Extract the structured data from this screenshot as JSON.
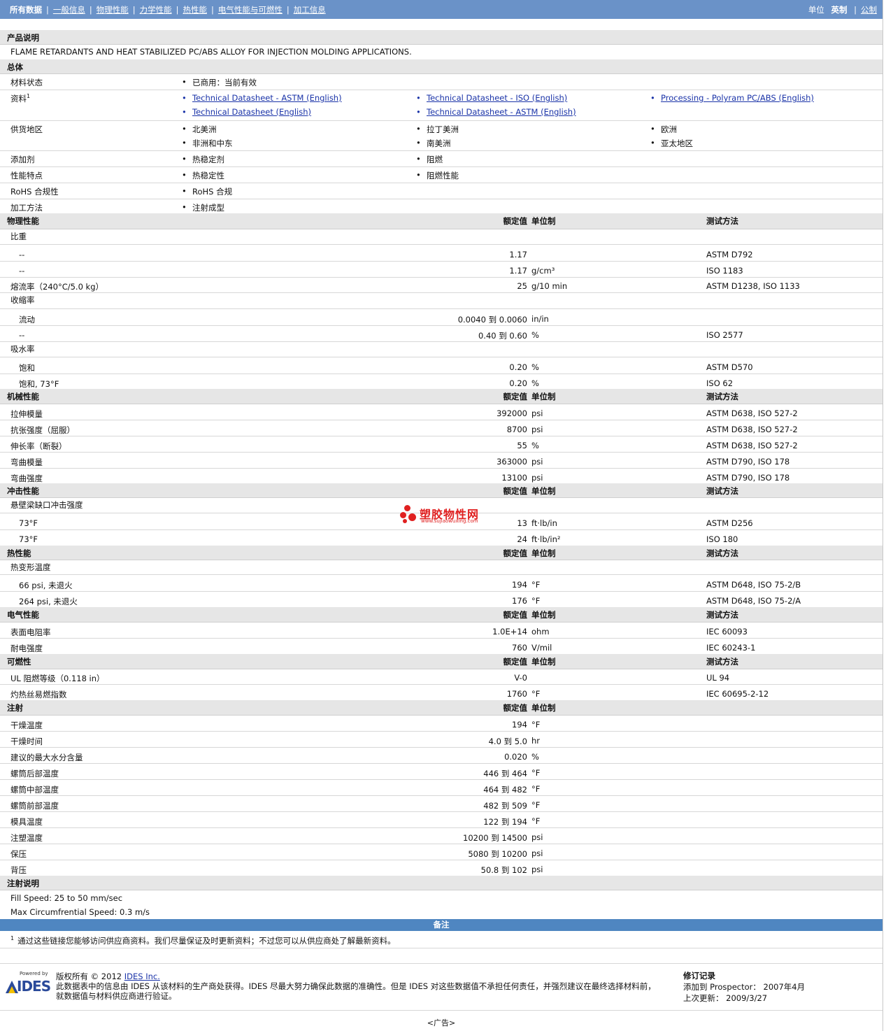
{
  "nav": {
    "tabs": [
      "所有数据",
      "一般信息",
      "物理性能",
      "力学性能",
      "热性能",
      "电气性能与可燃性",
      "加工信息"
    ],
    "units_label": "单位",
    "unit_imperial": "英制",
    "unit_metric": "公制"
  },
  "product_desc": {
    "title": "产品说明",
    "text": "FLAME RETARDANTS AND HEAT STABILIZED PC/ABS ALLOY FOR INJECTION MOLDING APPLICATIONS."
  },
  "general": {
    "title": "总体",
    "rows": [
      {
        "label": "材料状态",
        "items": [
          "已商用：当前有效"
        ]
      },
      {
        "label": "资料",
        "sup": "1",
        "items": [
          "Technical Datasheet - ASTM (English)",
          "Technical Datasheet - ISO (English)",
          "Processing - Polyram PC/ABS (English)",
          "Technical Datasheet (English)",
          "Technical Datasheet - ASTM (English)"
        ]
      },
      {
        "label": "供货地区",
        "items": [
          "北美洲",
          "拉丁美洲",
          "欧洲",
          "非洲和中东",
          "南美洲",
          "亚太地区"
        ]
      },
      {
        "label": "添加剂",
        "items": [
          "热稳定剂",
          "阻燃"
        ]
      },
      {
        "label": "性能特点",
        "items": [
          "热稳定性",
          "阻燃性能"
        ]
      },
      {
        "label": "RoHS 合规性",
        "items": [
          "RoHS 合规"
        ]
      },
      {
        "label": "加工方法",
        "items": [
          "注射成型"
        ]
      }
    ]
  },
  "headers": {
    "value": "额定值",
    "unit": "单位制",
    "method": "测试方法"
  },
  "physical": {
    "title": "物理性能",
    "rows": [
      {
        "label": "比重",
        "group": true
      },
      {
        "label": "--",
        "sub": true,
        "value": "1.17",
        "unit": "",
        "method": "ASTM D792"
      },
      {
        "label": "--",
        "sub": true,
        "value": "1.17",
        "unit": "g/cm³",
        "method": "ISO 1183"
      },
      {
        "label": "熔流率（240°C/5.0 kg）",
        "value": "25",
        "unit": "g/10 min",
        "method": "ASTM D1238, ISO 1133"
      },
      {
        "label": "收缩率",
        "group": true
      },
      {
        "label": "流动",
        "sub": true,
        "value": "0.0040 到  0.0060",
        "unit": "in/in",
        "method": ""
      },
      {
        "label": "--",
        "sub": true,
        "value": "0.40 到  0.60",
        "unit": "%",
        "method": "ISO 2577"
      },
      {
        "label": "吸水率",
        "group": true
      },
      {
        "label": "饱和",
        "sub": true,
        "value": "0.20",
        "unit": "%",
        "method": "ASTM D570"
      },
      {
        "label": "饱和, 73°F",
        "sub": true,
        "value": "0.20",
        "unit": "%",
        "method": "ISO 62"
      }
    ]
  },
  "mechanical": {
    "title": "机械性能",
    "rows": [
      {
        "label": "拉伸模量",
        "value": "392000",
        "unit": "psi",
        "method": "ASTM D638, ISO 527-2"
      },
      {
        "label": "抗张强度（屈服）",
        "value": "8700",
        "unit": "psi",
        "method": "ASTM D638, ISO 527-2"
      },
      {
        "label": "伸长率（断裂）",
        "value": "55",
        "unit": "%",
        "method": "ASTM D638, ISO 527-2"
      },
      {
        "label": "弯曲模量",
        "value": "363000",
        "unit": "psi",
        "method": "ASTM D790, ISO 178"
      },
      {
        "label": "弯曲强度",
        "value": "13100",
        "unit": "psi",
        "method": "ASTM D790, ISO 178"
      }
    ]
  },
  "impact": {
    "title": "冲击性能",
    "rows": [
      {
        "label": "悬壁梁缺口冲击强度",
        "group": true
      },
      {
        "label": "73°F",
        "sub": true,
        "value": "13",
        "unit": "ft·lb/in",
        "method": "ASTM D256"
      },
      {
        "label": "73°F",
        "sub": true,
        "value": "24",
        "unit": "ft·lb/in²",
        "method": "ISO 180"
      }
    ]
  },
  "thermal": {
    "title": "热性能",
    "rows": [
      {
        "label": "热变形温度",
        "group": true
      },
      {
        "label": "66 psi, 未退火",
        "sub": true,
        "value": "194",
        "unit": "°F",
        "method": "ASTM D648, ISO 75-2/B"
      },
      {
        "label": "264 psi, 未退火",
        "sub": true,
        "value": "176",
        "unit": "°F",
        "method": "ASTM D648, ISO 75-2/A"
      }
    ]
  },
  "electrical": {
    "title": "电气性能",
    "rows": [
      {
        "label": "表面电阻率",
        "value": "1.0E+14",
        "unit": "ohm",
        "method": "IEC 60093"
      },
      {
        "label": "耐电强度",
        "value": "760",
        "unit": "V/mil",
        "method": "IEC 60243-1"
      }
    ]
  },
  "flammability": {
    "title": "可燃性",
    "rows": [
      {
        "label": "UL 阻燃等级（0.118 in）",
        "value": "V-0",
        "unit": "",
        "method": "UL 94"
      },
      {
        "label": "灼热丝易燃指数",
        "value": "1760",
        "unit": "°F",
        "method": "IEC 60695-2-12"
      }
    ]
  },
  "injection": {
    "title": "注射",
    "rows": [
      {
        "label": "干燥温度",
        "value": "194",
        "unit": "°F"
      },
      {
        "label": "干燥时间",
        "value": "4.0 到  5.0",
        "unit": "hr"
      },
      {
        "label": "建议的最大水分含量",
        "value": "0.020",
        "unit": "%"
      },
      {
        "label": "螺筒后部温度",
        "value": "446 到  464",
        "unit": "°F"
      },
      {
        "label": "螺筒中部温度",
        "value": "464 到  482",
        "unit": "°F"
      },
      {
        "label": "螺筒前部温度",
        "value": "482 到  509",
        "unit": "°F"
      },
      {
        "label": "模具温度",
        "value": "122 到  194",
        "unit": "°F"
      },
      {
        "label": "注塑温度",
        "value": "10200 到  14500",
        "unit": "psi"
      },
      {
        "label": "保压",
        "value": "5080 到  10200",
        "unit": "psi"
      },
      {
        "label": "背压",
        "value": "50.8 到  102",
        "unit": "psi"
      }
    ]
  },
  "injection_notes": {
    "title": "注射说明",
    "lines": [
      "Fill Speed: 25 to 50 mm/sec",
      "Max Circumfrential Speed: 0.3 m/s"
    ]
  },
  "notes": {
    "title": "备注",
    "sup": "1",
    "text": "通过这些链接您能够访问供应商资料。我们尽量保证及时更新资料；不过您可以从供应商处了解最新资料。"
  },
  "footer": {
    "powered_by": "Powered by",
    "logo_text": "IDES",
    "copyright_prefix": "版权所有 © 2012 ",
    "copyright_link": "IDES Inc.",
    "disclaimer_1": "此数据表中的信息由 IDES 从该材料的生产商处获得。IDES 尽最大努力确保此数据的准确性。但是 IDES 对这些数据值不承担任何责任，并强烈建议在最终选择材料前，",
    "disclaimer_2": "就数据值与材料供应商进行验证。",
    "revision_title": "修订记录",
    "added_label": "添加到 Prospector：",
    "added_value": "2007年4月",
    "updated_label": "上次更新：",
    "updated_value": "2009/3/27"
  },
  "ad": "<广告>",
  "watermark": {
    "title": "塑胶物性网",
    "url": "www.sujiaowuxing.com"
  }
}
